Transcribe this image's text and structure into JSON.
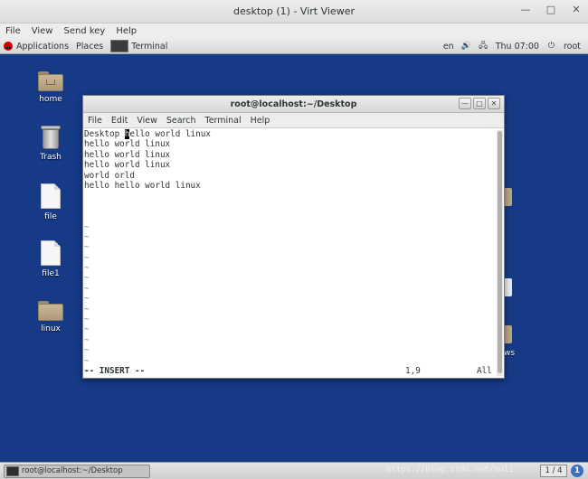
{
  "viewer": {
    "title": "desktop (1) - Virt Viewer",
    "menu": [
      "File",
      "View",
      "Send key",
      "Help"
    ],
    "controls": {
      "minimize": "—",
      "maximize": "□",
      "close": "✕"
    }
  },
  "panel": {
    "applications": "Applications",
    "places": "Places",
    "task": "Terminal",
    "lang": "en",
    "volume_icon": "🔊",
    "network_icon": "🖧",
    "clock": "Thu 07:00",
    "power_icon": "⏻",
    "user": "root"
  },
  "desktop_icons": [
    "home",
    "Trash",
    "file",
    "file1",
    "linux"
  ],
  "edge_label": "ws",
  "terminal": {
    "title": "root@localhost:~/Desktop",
    "menu": [
      "File",
      "Edit",
      "View",
      "Search",
      "Terminal",
      "Help"
    ],
    "controls": {
      "minimize": "—",
      "maximize": "□",
      "close": "✕"
    },
    "first_line": {
      "before": "Desktop ",
      "cursor": "h",
      "after": "ello world linux"
    },
    "lines": [
      "hello world linux",
      "hello world linux",
      "hello world linux",
      "world orld",
      "hello hello world linux"
    ],
    "tildes": [
      "~",
      "~",
      "~",
      "~",
      "~",
      "~",
      "~",
      "~",
      "~",
      "~",
      "~",
      "~",
      "~",
      "~",
      "~"
    ],
    "status": {
      "mode": "-- INSERT --",
      "position": "1,9",
      "scroll": "All"
    }
  },
  "taskbar": {
    "task": "root@localhost:~/Desktop",
    "watermark": "https://blog.csdn.net/muli",
    "pager": "1 / 4",
    "notify": "1"
  }
}
